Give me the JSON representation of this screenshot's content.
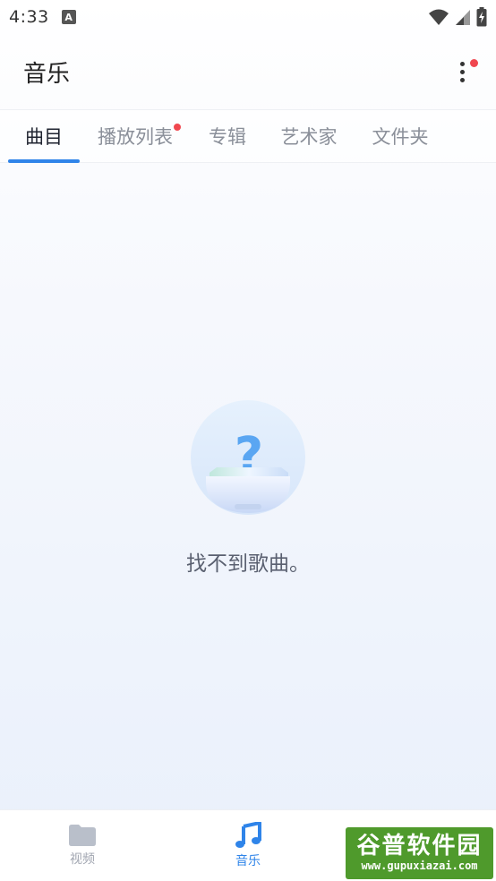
{
  "status_bar": {
    "time": "4:33",
    "notification_icon": "A",
    "icons": [
      "wifi-icon",
      "signal-icon",
      "battery-charging-icon"
    ]
  },
  "appbar": {
    "title": "音乐",
    "more_icon": "more-vertical-icon",
    "badge_color": "#f0474f"
  },
  "tabs": [
    {
      "label": "曲目",
      "active": true
    },
    {
      "label": "播放列表",
      "badge": true
    },
    {
      "label": "专辑"
    },
    {
      "label": "艺术家"
    },
    {
      "label": "文件夹"
    }
  ],
  "empty_state": {
    "icon": "empty-box-question-icon",
    "message": "找不到歌曲。"
  },
  "bottom_nav": [
    {
      "label": "视频",
      "icon": "folder-icon",
      "active": false
    },
    {
      "label": "音乐",
      "icon": "music-note-icon",
      "active": true
    }
  ],
  "watermark": {
    "logo": "谷普软件园",
    "url": "www.gupuxiazai.com"
  },
  "colors": {
    "accent": "#2f84e9",
    "badge": "#f0474f",
    "tab_inactive": "#8a8f99",
    "tab_active": "#1f2430",
    "nav_inactive": "#a0a5b0"
  }
}
